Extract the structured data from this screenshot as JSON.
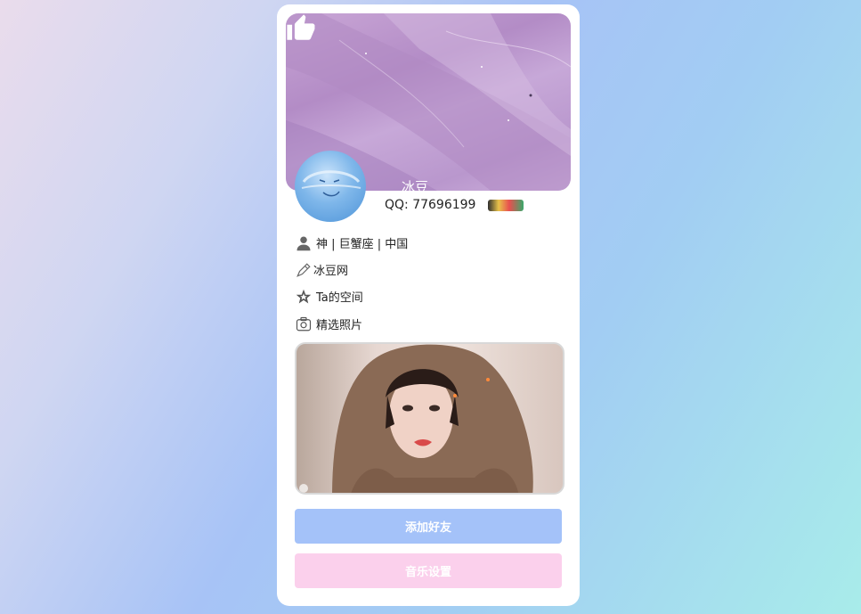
{
  "profile": {
    "name": "冰豆",
    "qq_label": "QQ: 77696199",
    "info": [
      {
        "icon": "user-icon",
        "text": "神 | 巨蟹座 | 中国"
      },
      {
        "icon": "pen-icon",
        "text": "冰豆网"
      },
      {
        "icon": "star-icon",
        "text": "Ta的空间"
      },
      {
        "icon": "camera-icon",
        "text": "精选照片"
      }
    ]
  },
  "buttons": {
    "add_friend": "添加好友",
    "music_settings": "音乐设置"
  },
  "colors": {
    "add_button": "#a4c2f9",
    "music_button": "#fbd0ec"
  }
}
